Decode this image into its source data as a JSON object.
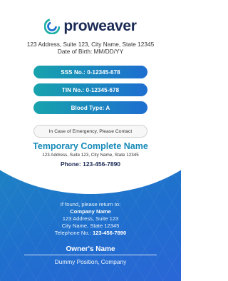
{
  "brand": {
    "name": "proweaver",
    "logo_icon": "proweaver-swirl-icon",
    "accent": "#1589b7",
    "dark": "#1b2a55"
  },
  "card_holder": {
    "address": "123 Address, Suite 123, City Name, State 12345",
    "dob": "Date of Birth: MM/DD/YY"
  },
  "info_pills": [
    {
      "label": "SSS No.: 0-12345-678"
    },
    {
      "label": "TIN No.: 0-12345-678"
    },
    {
      "label": "Blood Type: A"
    }
  ],
  "emergency": {
    "label": "In Case of Emergency, Please Contact",
    "name": "Temporary Complete Name",
    "address": "123 Address, Suite 123, City Name, State 12345",
    "phone": "Phone: 123-456-7890"
  },
  "found": {
    "intro": "If found, please return to:",
    "company": "Company Name",
    "address1": "123 Address, Suite 123",
    "address2": "City Name, State 12345",
    "telephone_label": "Telephone No.: ",
    "telephone_value": "123-456-7890"
  },
  "owner": {
    "name": "Owner's Name",
    "position": "Dummy Position, Company"
  }
}
